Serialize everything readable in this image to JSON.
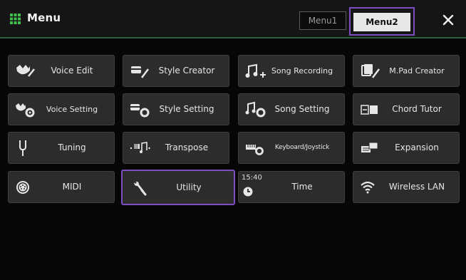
{
  "header": {
    "title": "Menu",
    "tabs": [
      {
        "label": "Menu1",
        "active": false
      },
      {
        "label": "Menu2",
        "active": true
      }
    ]
  },
  "tiles": [
    {
      "label": "Voice Edit",
      "icon": "voice-edit-icon"
    },
    {
      "label": "Style Creator",
      "icon": "style-creator-icon"
    },
    {
      "label": "Song Recording",
      "icon": "song-recording-icon"
    },
    {
      "label": "M.Pad Creator",
      "icon": "mpad-creator-icon"
    },
    {
      "label": "Voice Setting",
      "icon": "voice-setting-icon"
    },
    {
      "label": "Style Setting",
      "icon": "style-setting-icon"
    },
    {
      "label": "Song Setting",
      "icon": "song-setting-icon"
    },
    {
      "label": "Chord Tutor",
      "icon": "chord-tutor-icon"
    },
    {
      "label": "Tuning",
      "icon": "tuning-fork-icon"
    },
    {
      "label": "Transpose",
      "icon": "transpose-icon"
    },
    {
      "label": "Keyboard/Joystick",
      "icon": "keyboard-joystick-icon"
    },
    {
      "label": "Expansion",
      "icon": "expansion-icon"
    },
    {
      "label": "MIDI",
      "icon": "midi-icon"
    },
    {
      "label": "Utility",
      "icon": "wrench-icon",
      "selected": true
    },
    {
      "label": "Time",
      "icon": "clock-icon",
      "clock_text": "15:40"
    },
    {
      "label": "Wireless LAN",
      "icon": "wifi-icon"
    }
  ],
  "colors": {
    "background": "#060606",
    "tile": "#2c2c2c",
    "selection": "#7c4fc2",
    "header_line": "#2f5f3c",
    "menu_icon": "#3fbf4a"
  }
}
